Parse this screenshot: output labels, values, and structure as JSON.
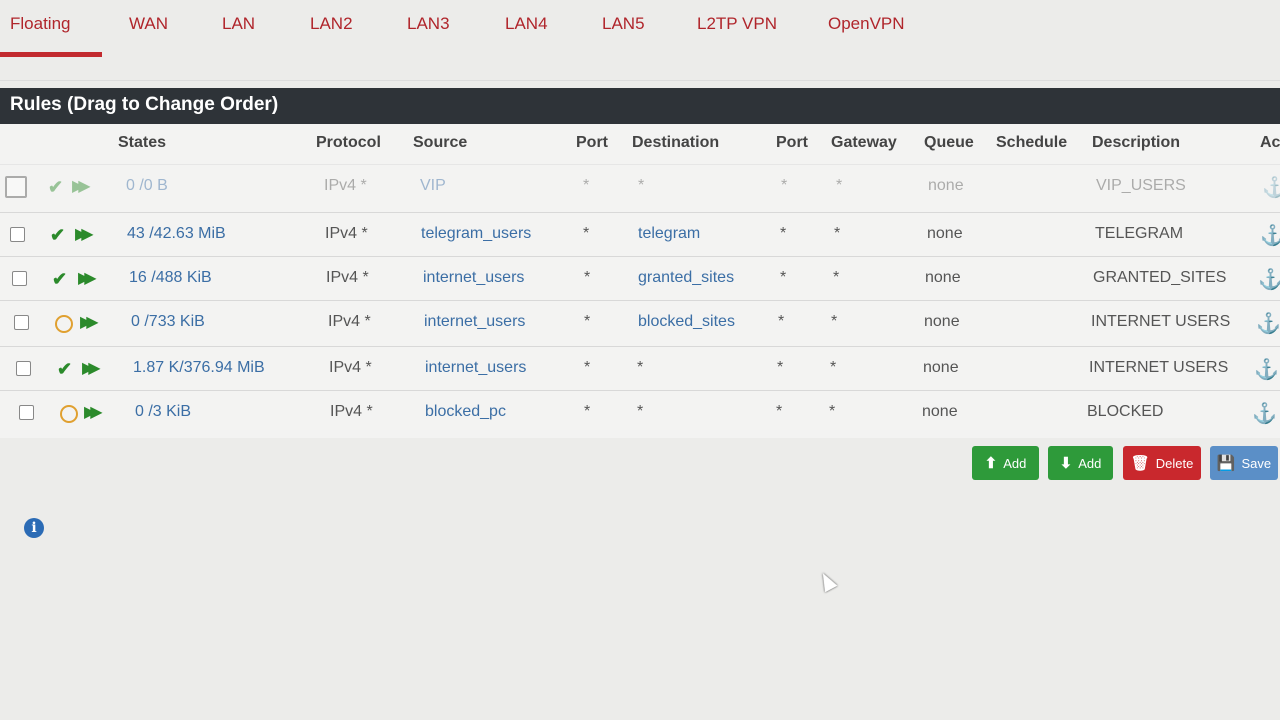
{
  "tabs": [
    "Floating",
    "WAN",
    "LAN",
    "LAN2",
    "LAN3",
    "LAN4",
    "LAN5",
    "L2TP VPN",
    "OpenVPN"
  ],
  "panel_title": "Rules (Drag to Change Order)",
  "columns": {
    "states": "States",
    "protocol": "Protocol",
    "source": "Source",
    "port1": "Port",
    "destination": "Destination",
    "port2": "Port",
    "gateway": "Gateway",
    "queue": "Queue",
    "schedule": "Schedule",
    "description": "Description",
    "actions": "Ac"
  },
  "rows": [
    {
      "states": "0 /0 B",
      "protocol": "IPv4 *",
      "source": "VIP",
      "port1": "*",
      "destination": "*",
      "port2": "*",
      "gateway": "*",
      "queue": "none",
      "description": "VIP_USERS",
      "status": "pass",
      "disabled": true
    },
    {
      "states": "43 /42.63 MiB",
      "protocol": "IPv4 *",
      "source": "telegram_users",
      "port1": "*",
      "destination": "telegram",
      "port2": "*",
      "gateway": "*",
      "queue": "none",
      "description": "TELEGRAM",
      "status": "pass",
      "disabled": false
    },
    {
      "states": "16 /488 KiB",
      "protocol": "IPv4 *",
      "source": "internet_users",
      "port1": "*",
      "destination": "granted_sites",
      "port2": "*",
      "gateway": "*",
      "queue": "none",
      "description": "GRANTED_SITES",
      "status": "pass",
      "disabled": false
    },
    {
      "states": "0 /733 KiB",
      "protocol": "IPv4 *",
      "source": "internet_users",
      "port1": "*",
      "destination": "blocked_sites",
      "port2": "*",
      "gateway": "*",
      "queue": "none",
      "description": "INTERNET USERS",
      "status": "block",
      "disabled": false
    },
    {
      "states": "1.87 K/376.94 MiB",
      "protocol": "IPv4 *",
      "source": "internet_users",
      "port1": "*",
      "destination": "*",
      "port2": "*",
      "gateway": "*",
      "queue": "none",
      "description": "INTERNET USERS",
      "status": "pass",
      "disabled": false
    },
    {
      "states": "0 /3 KiB",
      "protocol": "IPv4 *",
      "source": "blocked_pc",
      "port1": "*",
      "destination": "*",
      "port2": "*",
      "gateway": "*",
      "queue": "none",
      "description": "BLOCKED",
      "status": "block",
      "disabled": false
    }
  ],
  "buttons": {
    "add_top": "Add",
    "add_bottom": "Add",
    "delete": "Delete",
    "save": "Save"
  },
  "colors": {
    "brand_red": "#c22a2f",
    "pass_green": "#2b8a2b",
    "add_green": "#2e9a3a",
    "delete_red": "#c9282d",
    "save_blue": "#5b8fc7",
    "link_blue": "#3b6ea5"
  }
}
